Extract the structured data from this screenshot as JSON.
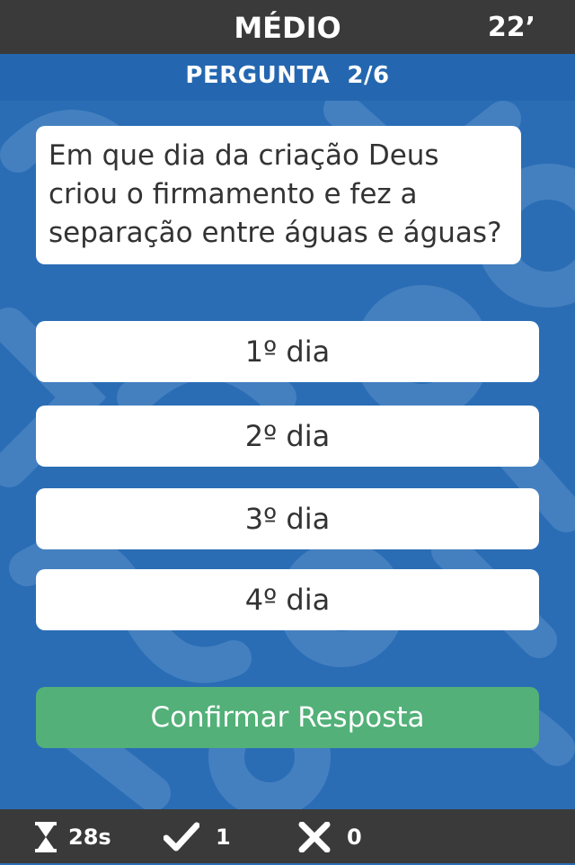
{
  "header": {
    "level": "MÉDIO",
    "time_limit": "22’"
  },
  "progress": {
    "label": "PERGUNTA  2/6"
  },
  "question": {
    "text": "Em que dia da criação Deus criou o firmamento e fez a separação entre águas e águas?"
  },
  "answers": [
    {
      "label": "1º dia"
    },
    {
      "label": "2º dia"
    },
    {
      "label": "3º dia"
    },
    {
      "label": "4º dia"
    }
  ],
  "confirm": {
    "label": "Confirmar Resposta"
  },
  "stats": {
    "timer": {
      "icon": "hourglass-icon",
      "value": "28s"
    },
    "correct": {
      "icon": "check-icon",
      "value": "1"
    },
    "wrong": {
      "icon": "x-icon",
      "value": "0"
    }
  },
  "colors": {
    "background": "#2a6db5",
    "bars": "#3a3a3a",
    "confirm": "#52b078",
    "card": "#ffffff"
  }
}
